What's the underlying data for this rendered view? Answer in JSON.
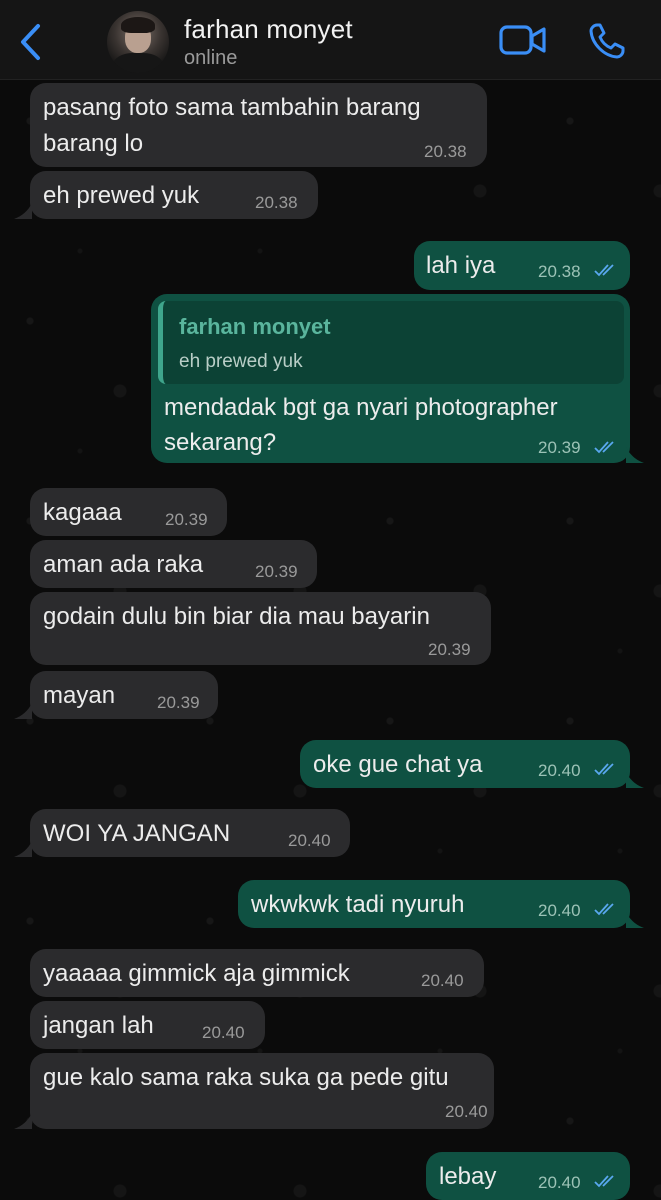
{
  "header": {
    "contact_name": "farhan monyet",
    "status": "online",
    "icons": {
      "back": "chevron-left-icon",
      "video": "video-camera-icon",
      "call": "phone-icon"
    },
    "accent_color": "#3a8ef6"
  },
  "colors": {
    "incoming_bubble": "#2b2b2d",
    "outgoing_bubble": "#0f5142",
    "read_ticks": "#5aa8f0"
  },
  "messages": [
    {
      "dir": "in",
      "text_lines": [
        "pasang foto sama tambahin barang",
        "barang lo"
      ],
      "time": "20.38"
    },
    {
      "dir": "in",
      "text_lines": [
        "eh prewed yuk"
      ],
      "time": "20.38"
    },
    {
      "dir": "out",
      "text_lines": [
        "lah iya"
      ],
      "time": "20.38",
      "read": true
    },
    {
      "dir": "out",
      "quote": {
        "name": "farhan monyet",
        "text": "eh prewed yuk"
      },
      "text_lines": [
        "mendadak bgt ga nyari photographer",
        "sekarang?"
      ],
      "time": "20.39",
      "read": true
    },
    {
      "dir": "in",
      "text_lines": [
        "kagaaa"
      ],
      "time": "20.39"
    },
    {
      "dir": "in",
      "text_lines": [
        "aman ada raka"
      ],
      "time": "20.39"
    },
    {
      "dir": "in",
      "text_lines": [
        "godain dulu bin biar dia mau bayarin"
      ],
      "time": "20.39"
    },
    {
      "dir": "in",
      "text_lines": [
        "mayan"
      ],
      "time": "20.39"
    },
    {
      "dir": "out",
      "text_lines": [
        "oke gue chat ya"
      ],
      "time": "20.40",
      "read": true
    },
    {
      "dir": "in",
      "text_lines": [
        "WOI YA JANGAN"
      ],
      "time": "20.40"
    },
    {
      "dir": "out",
      "text_lines": [
        "wkwkwk tadi nyuruh"
      ],
      "time": "20.40",
      "read": true
    },
    {
      "dir": "in",
      "text_lines": [
        "yaaaaa gimmick aja gimmick"
      ],
      "time": "20.40"
    },
    {
      "dir": "in",
      "text_lines": [
        "jangan lah"
      ],
      "time": "20.40"
    },
    {
      "dir": "in",
      "text_lines": [
        "gue kalo sama raka suka ga pede gitu"
      ],
      "time": "20.40"
    },
    {
      "dir": "out",
      "text_lines": [
        "lebay"
      ],
      "time": "20.40",
      "read": true
    }
  ]
}
